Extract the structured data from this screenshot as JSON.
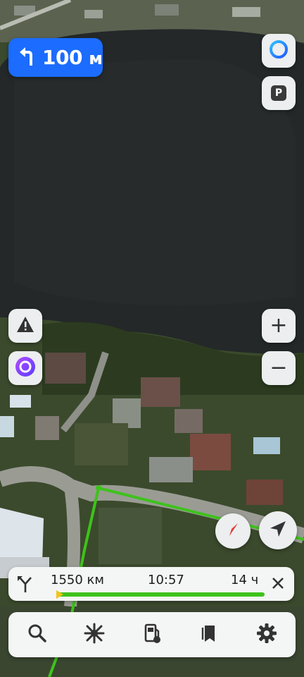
{
  "maneuver": {
    "distance_value": "100",
    "distance_unit": "м",
    "direction_icon": "turn-left-icon"
  },
  "right_controls": {
    "alice_icon": "alice-ring-icon",
    "parking_label": "P",
    "zoom_in_label": "+",
    "zoom_out_label": "−"
  },
  "left_controls": {
    "road_event_icon": "warning-icon",
    "voice_assistant_icon": "alice-voice-icon"
  },
  "route_info": {
    "remaining_distance": "1550 км",
    "arrival_time": "10:57",
    "travel_time": "14 ч",
    "progress_fraction": 0.0,
    "close_icon": "close-icon"
  },
  "bottom_nav": [
    {
      "name": "search",
      "icon": "search-icon"
    },
    {
      "name": "overview",
      "icon": "route-overview-icon"
    },
    {
      "name": "gas-stations",
      "icon": "fuel-icon"
    },
    {
      "name": "bookmarks",
      "icon": "bookmark-icon"
    },
    {
      "name": "settings",
      "icon": "gear-icon"
    }
  ],
  "colors": {
    "accent": "#1b6cff",
    "route": "#3ec21c",
    "compass_red": "#e53935"
  }
}
